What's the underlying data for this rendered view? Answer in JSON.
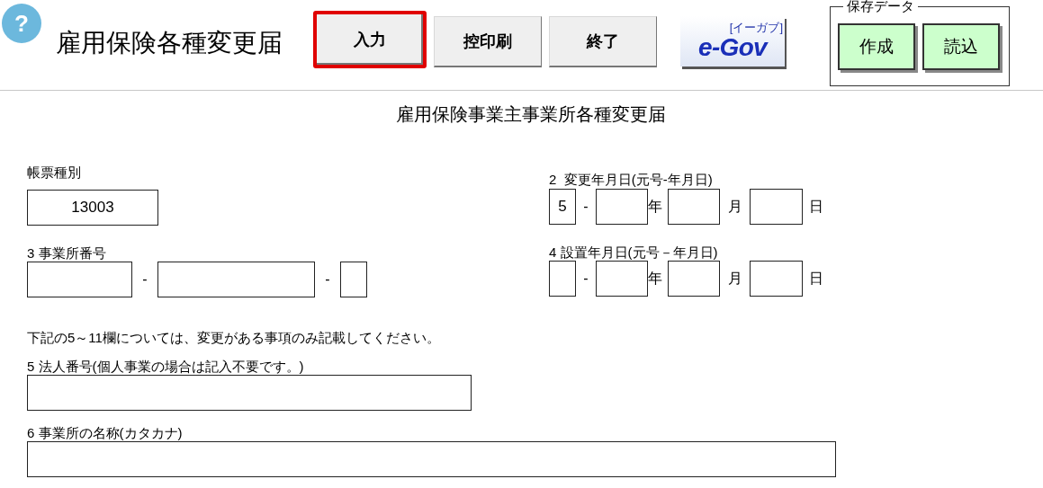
{
  "help_button": {
    "label": "?"
  },
  "app_title": "雇用保険各種変更届",
  "toolbar": [
    {
      "label": "入力",
      "selected": true
    },
    {
      "label": "控印刷",
      "selected": false
    },
    {
      "label": "終了",
      "selected": false
    }
  ],
  "logo": {
    "text": "e-Gov",
    "subtext": "[イーガブ]"
  },
  "save_data": {
    "title": "保存データ",
    "buttons": [
      "作成",
      "読込"
    ]
  },
  "form": {
    "title": "雇用保険事業主事業所各種変更届",
    "form_type": {
      "label": "帳票種別",
      "value": "13003"
    },
    "change_date": {
      "label": "2  変更年月日(元号-年月日)",
      "parts": [
        {
          "kind": "field",
          "value": "5"
        },
        {
          "kind": "text",
          "text": "-"
        },
        {
          "kind": "field"
        },
        {
          "kind": "text",
          "text": "年"
        },
        {
          "kind": "field"
        },
        {
          "kind": "text",
          "text": "月"
        },
        {
          "kind": "field"
        },
        {
          "kind": "text",
          "text": "日"
        }
      ]
    },
    "office_number": {
      "label": "3 事業所番号",
      "parts": [
        {
          "kind": "field"
        },
        {
          "kind": "text",
          "text": "-"
        },
        {
          "kind": "field"
        },
        {
          "kind": "text",
          "text": "-"
        },
        {
          "kind": "field"
        }
      ]
    },
    "setup_date": {
      "label": "4 設置年月日(元号－年月日)",
      "parts": [
        {
          "kind": "field"
        },
        {
          "kind": "text",
          "text": "-"
        },
        {
          "kind": "field"
        },
        {
          "kind": "text",
          "text": "年"
        },
        {
          "kind": "field"
        },
        {
          "kind": "text",
          "text": "月"
        },
        {
          "kind": "field"
        },
        {
          "kind": "text",
          "text": "日"
        }
      ]
    },
    "note": "下記の5～11欄については、変更がある事項のみ記載してください。",
    "corporate_number": {
      "label": "5 法人番号(個人事業の場合は記入不要です。)"
    },
    "office_name_kana": {
      "label": "6 事業所の名称(カタカナ)"
    }
  }
}
